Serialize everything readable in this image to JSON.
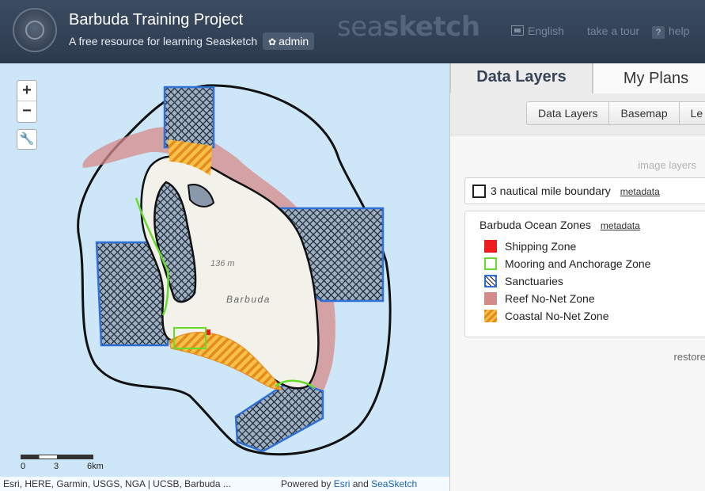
{
  "header": {
    "title": "Barbuda Training Project",
    "subtitle": "A free resource for learning Seasketch",
    "admin_label": "admin",
    "brand_left": "sea",
    "brand_right": "sketch",
    "links": {
      "language": "English",
      "tour": "take a tour",
      "help": "help",
      "help_glyph": "?"
    }
  },
  "map": {
    "zoom_in": "+",
    "zoom_out": "−",
    "tool_icon": "wrench-icon",
    "place_label": "Barbuda",
    "elevation_label": "136 m",
    "scale": {
      "labels": [
        "0",
        "3",
        "6km"
      ]
    },
    "attribution": {
      "sources": "Esri, HERE, Garmin, USGS, NGA | UCSB, Barbuda ...",
      "powered_prefix": "Powered by",
      "esri": "Esri",
      "and": "and",
      "seasketch": "SeaSketch"
    }
  },
  "panel": {
    "tabs": [
      {
        "label": "Data Layers",
        "active": true
      },
      {
        "label": "My Plans",
        "active": false
      }
    ],
    "subtabs": [
      "Data Layers",
      "Basemap",
      "Le"
    ],
    "image_layers_label": "image layers",
    "boundary_layer": {
      "label": "3 nautical mile boundary",
      "metadata": "metadata",
      "checked": false
    },
    "zones": {
      "title": "Barbuda Ocean Zones",
      "metadata": "metadata",
      "legend": [
        {
          "label": "Shipping Zone",
          "color": "#ee1c1c",
          "style": "fill"
        },
        {
          "label": "Mooring and Anchorage Zone",
          "color": "#66dd2a",
          "style": "outline"
        },
        {
          "label": "Sanctuaries",
          "color": "#2f6fd6",
          "style": "hatch"
        },
        {
          "label": "Reef No-Net Zone",
          "color": "#d58a8a",
          "style": "fill"
        },
        {
          "label": "Coastal No-Net Zone",
          "color": "#f0a020",
          "style": "stripe"
        }
      ]
    },
    "restore_label": "restore"
  },
  "colors": {
    "header_bg": "#34445a",
    "water": "#cde6f8",
    "land": "#f2f1ea",
    "sanctuary_outline": "#2f6fd6",
    "reef": "#d58a8a",
    "coastal": "#f0a020",
    "mooring": "#66dd2a"
  }
}
